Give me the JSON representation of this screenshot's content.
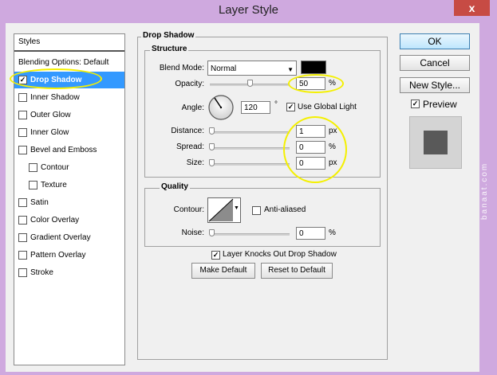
{
  "window": {
    "title": "Layer Style",
    "close_glyph": "x"
  },
  "watermark": "banaat.com",
  "styles_list": {
    "header": "Styles",
    "blending": "Blending Options: Default",
    "items": [
      {
        "label": "Drop Shadow",
        "checked": true,
        "selected": true
      },
      {
        "label": "Inner Shadow",
        "checked": false
      },
      {
        "label": "Outer Glow",
        "checked": false
      },
      {
        "label": "Inner Glow",
        "checked": false
      },
      {
        "label": "Bevel and Emboss",
        "checked": false
      },
      {
        "label": "Contour",
        "checked": false,
        "indent": true
      },
      {
        "label": "Texture",
        "checked": false,
        "indent": true
      },
      {
        "label": "Satin",
        "checked": false
      },
      {
        "label": "Color Overlay",
        "checked": false
      },
      {
        "label": "Gradient Overlay",
        "checked": false
      },
      {
        "label": "Pattern Overlay",
        "checked": false
      },
      {
        "label": "Stroke",
        "checked": false
      }
    ]
  },
  "drop_shadow": {
    "title": "Drop Shadow",
    "structure": {
      "title": "Structure",
      "blend_mode_label": "Blend Mode:",
      "blend_mode_value": "Normal",
      "shadow_color": "#000000",
      "opacity_label": "Opacity:",
      "opacity_value": "50",
      "opacity_unit": "%",
      "angle_label": "Angle:",
      "angle_value": "120",
      "angle_unit": "°",
      "use_global_light_label": "Use Global Light",
      "use_global_light": true,
      "distance_label": "Distance:",
      "distance_value": "1",
      "distance_unit": "px",
      "spread_label": "Spread:",
      "spread_value": "0",
      "spread_unit": "%",
      "size_label": "Size:",
      "size_value": "0",
      "size_unit": "px"
    },
    "quality": {
      "title": "Quality",
      "contour_label": "Contour:",
      "anti_aliased_label": "Anti-aliased",
      "anti_aliased": false,
      "noise_label": "Noise:",
      "noise_value": "0",
      "noise_unit": "%"
    },
    "knocks_out_label": "Layer Knocks Out Drop Shadow",
    "knocks_out": true,
    "make_default_label": "Make Default",
    "reset_default_label": "Reset to Default"
  },
  "buttons": {
    "ok": "OK",
    "cancel": "Cancel",
    "new_style": "New Style..."
  },
  "preview": {
    "label": "Preview",
    "checked": true
  },
  "colors": {
    "selection": "#3399ff",
    "highlight": "#f4f000",
    "frame": "#cfa9df"
  }
}
